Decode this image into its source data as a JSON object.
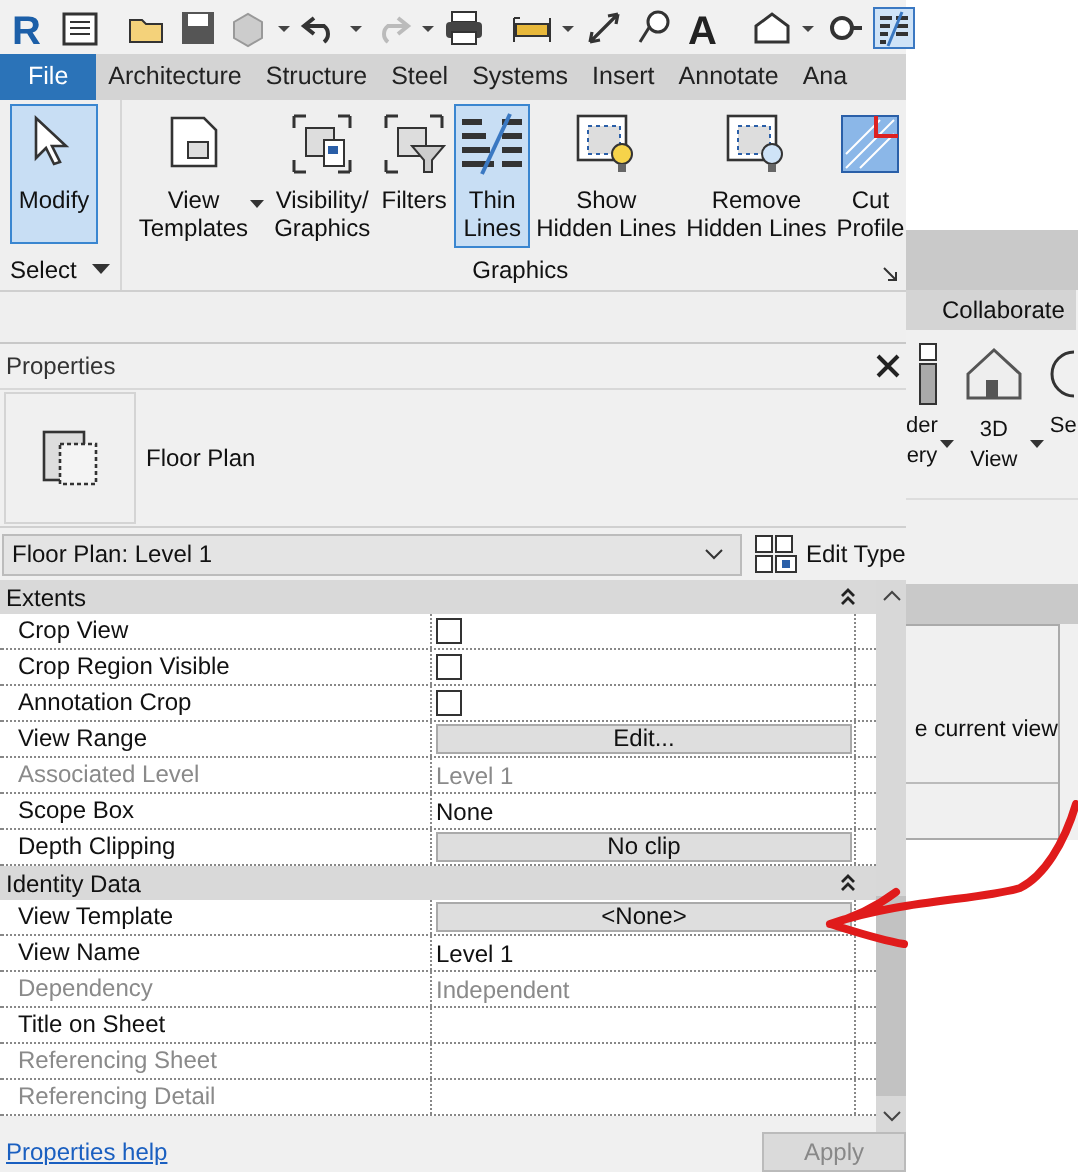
{
  "quick_access": {
    "logo": "R",
    "text_glyph": "A"
  },
  "ribbon": {
    "tabs": [
      {
        "label": "File",
        "selected": true
      },
      {
        "label": "Architecture",
        "selected": false
      },
      {
        "label": "Structure",
        "selected": false
      },
      {
        "label": "Steel",
        "selected": false
      },
      {
        "label": "Systems",
        "selected": false
      },
      {
        "label": "Insert",
        "selected": false
      },
      {
        "label": "Annotate",
        "selected": false
      },
      {
        "label": "Ana",
        "selected": false
      }
    ],
    "panels": [
      {
        "label": "Select",
        "dropdown": true,
        "buttons": [
          {
            "label": "Modify",
            "selected": true,
            "dropdown": false
          }
        ]
      },
      {
        "label": "Graphics",
        "dropdown": false,
        "buttons": [
          {
            "label": "View\nTemplates",
            "selected": false,
            "dropdown": true
          },
          {
            "label": "Visibility/\nGraphics",
            "selected": false,
            "dropdown": false
          },
          {
            "label": "Filters",
            "selected": false,
            "dropdown": false
          },
          {
            "label": "Thin\nLines",
            "selected": true,
            "dropdown": false
          },
          {
            "label": "Show\nHidden Lines",
            "selected": false,
            "dropdown": false
          },
          {
            "label": "Remove\nHidden Lines",
            "selected": false,
            "dropdown": false
          },
          {
            "label": "Cut\nProfile",
            "selected": false,
            "dropdown": false
          }
        ]
      }
    ]
  },
  "back_window": {
    "tab": "Collaborate",
    "buttons": [
      {
        "label": "der\nery",
        "dropdown": true
      },
      {
        "label": "3D\nView",
        "dropdown": true
      },
      {
        "label": "Se",
        "dropdown": false
      }
    ],
    "dialog_text": "e current view"
  },
  "properties": {
    "title": "Properties",
    "type_name": "Floor Plan",
    "selector": "Floor Plan: Level 1",
    "edit_type": "Edit Type",
    "groups": [
      {
        "name": "Extents",
        "expanded": true,
        "rows": [
          {
            "name": "Crop View",
            "kind": "checkbox",
            "checked": false,
            "disabled": false
          },
          {
            "name": "Crop Region Visible",
            "kind": "checkbox",
            "checked": false,
            "disabled": false
          },
          {
            "name": "Annotation Crop",
            "kind": "checkbox",
            "checked": false,
            "disabled": false
          },
          {
            "name": "View Range",
            "kind": "button",
            "value": "Edit...",
            "disabled": false
          },
          {
            "name": "Associated Level",
            "kind": "text",
            "value": "Level 1",
            "disabled": true
          },
          {
            "name": "Scope Box",
            "kind": "text",
            "value": "None",
            "disabled": false
          },
          {
            "name": "Depth Clipping",
            "kind": "button",
            "value": "No clip",
            "disabled": false
          }
        ]
      },
      {
        "name": "Identity Data",
        "expanded": true,
        "rows": [
          {
            "name": "View Template",
            "kind": "button",
            "value": "<None>",
            "disabled": false
          },
          {
            "name": "View Name",
            "kind": "text",
            "value": "Level 1",
            "disabled": false
          },
          {
            "name": "Dependency",
            "kind": "text",
            "value": "Independent",
            "disabled": true
          },
          {
            "name": "Title on Sheet",
            "kind": "text",
            "disabled": false
          },
          {
            "name": "Referencing Sheet",
            "kind": "text",
            "disabled": true
          },
          {
            "name": "Referencing Detail",
            "kind": "text",
            "disabled": true
          }
        ]
      }
    ],
    "help_link": "Properties help",
    "apply": {
      "label": "Apply",
      "disabled": true
    }
  }
}
